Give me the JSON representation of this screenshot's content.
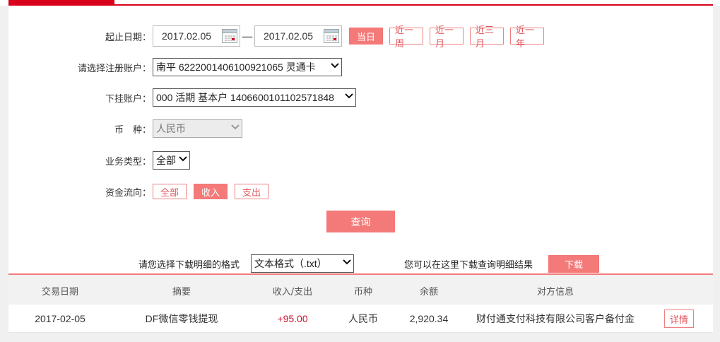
{
  "filters": {
    "date_label": "起止日期：",
    "start_date": "2017.02.05",
    "end_date": "2017.02.05",
    "date_separator": "—",
    "range_buttons": [
      "当日",
      "近一周",
      "近一月",
      "近三月",
      "近一年"
    ],
    "active_range": "当日",
    "account_label": "请选择注册账户：",
    "account_value": "南平 6222001406100921065 灵通卡",
    "sub_account_label": "下挂账户：",
    "sub_account_value": "000 活期 基本户 1406600101102571848",
    "currency_label": "币　种：",
    "currency_value": "人民币",
    "business_type_label": "业务类型：",
    "business_type_value": "全部",
    "flow_label": "资金流向：",
    "flow_buttons": [
      "全部",
      "收入",
      "支出"
    ],
    "active_flow": "收入",
    "query_label": "查询"
  },
  "download": {
    "format_label": "请您选择下载明细的格式",
    "format_value": "文本格式（.txt）",
    "hint": "您可以在这里下载查询明细结果",
    "button_label": "下载"
  },
  "table": {
    "columns": [
      "交易日期",
      "摘要",
      "收入/支出",
      "币种",
      "余额",
      "对方信息"
    ],
    "rows": [
      {
        "date": "2017-02-05",
        "summary": "DF微信零钱提现",
        "amount": "+95.00",
        "currency": "人民币",
        "balance": "2,920.34",
        "counterparty": "财付通支付科技有限公司客户备付金",
        "action": "详情"
      }
    ]
  },
  "colors": {
    "brand_red": "#d9001b",
    "accent": "#f47a7a",
    "income": "#c8102e"
  }
}
